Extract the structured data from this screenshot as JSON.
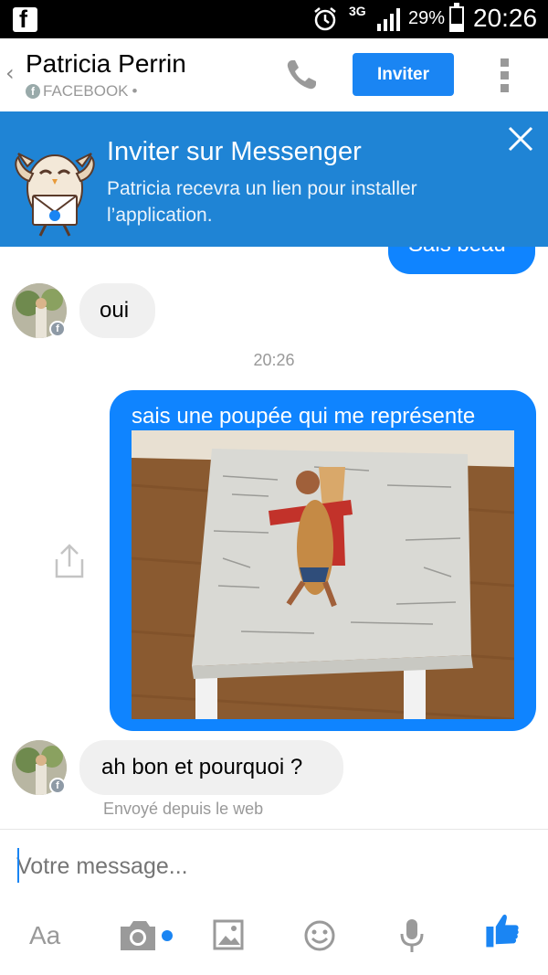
{
  "status_bar": {
    "network": "3G",
    "battery_percent": "29%",
    "time": "20:26",
    "icons": [
      "facebook-icon",
      "alarm-icon",
      "signal-icon",
      "battery-icon"
    ]
  },
  "header": {
    "name": "Patricia Perrin",
    "source": "FACEBOOK",
    "source_separator": "•",
    "invite_label": "Inviter"
  },
  "banner": {
    "title": "Inviter sur Messenger",
    "text": "Patricia recevra un lien pour installer l’application."
  },
  "messages": {
    "partial_sent": "Sais beau",
    "received_1": "oui",
    "timestamp": "20:26",
    "sent_with_image": "sais une poupée qui me représente",
    "received_2": "ah bon et pourquoi ?",
    "received_2_caption": "Envoyé depuis le web"
  },
  "composer": {
    "placeholder": "Votre message...",
    "aa_label": "Aa"
  },
  "colors": {
    "accent": "#1a85f3",
    "bubble_sent": "#0f84ff",
    "bubble_received": "#f0f0f0",
    "banner": "#1f84d5"
  }
}
